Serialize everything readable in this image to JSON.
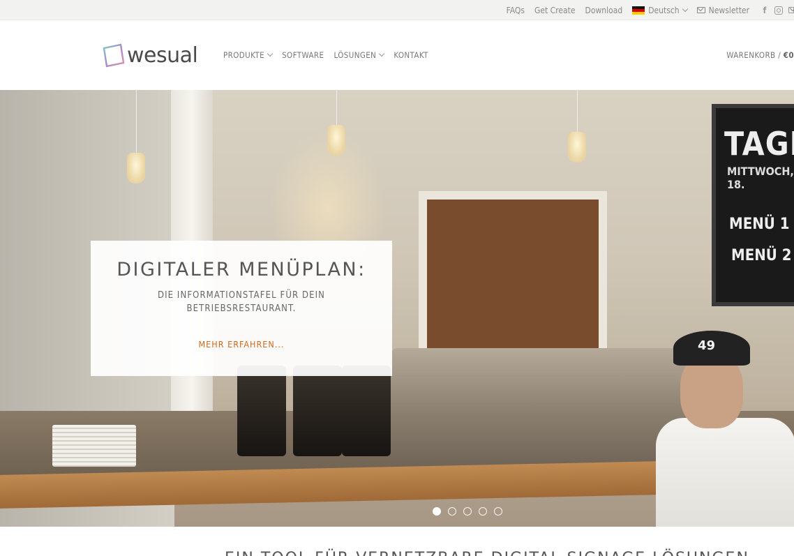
{
  "topbar": {
    "links": [
      "FAQs",
      "Get Create",
      "Download"
    ],
    "language": "Deutsch",
    "newsletter": "Newsletter",
    "icons": [
      "facebook-icon",
      "instagram-icon",
      "mail-icon"
    ]
  },
  "header": {
    "logo_text": "wesual",
    "nav": [
      {
        "label": "PRODUKTE",
        "dropdown": true
      },
      {
        "label": "SOFTWARE",
        "dropdown": false
      },
      {
        "label": "LÖSUNGEN",
        "dropdown": true
      },
      {
        "label": "KONTAKT",
        "dropdown": false
      }
    ],
    "cart_label": "WARENKORB /",
    "cart_value": "€0"
  },
  "hero": {
    "title": "DIGITALER MENÜPLAN:",
    "subtitle": "DIE INFORMATIONSTAFEL FÜR DEIN BETRIEBSRESTAURANT.",
    "cta": "MEHR ERFAHREN...",
    "image_text": {
      "board_title": "TAGES",
      "board_sub": "MITTWOCH, 18.",
      "menu_1": "MENÜ 1",
      "menu_2": "MENÜ 2",
      "cap": "49"
    },
    "slides_total": 5,
    "active_slide": 1
  },
  "section": {
    "heading": "EIN TOOL FÜR VERNETZBARE DIGITAL SIGNAGE LÖSUNGEN"
  },
  "colors": {
    "accent": "#d2691e",
    "topbar_bg": "#f2f2f0"
  }
}
